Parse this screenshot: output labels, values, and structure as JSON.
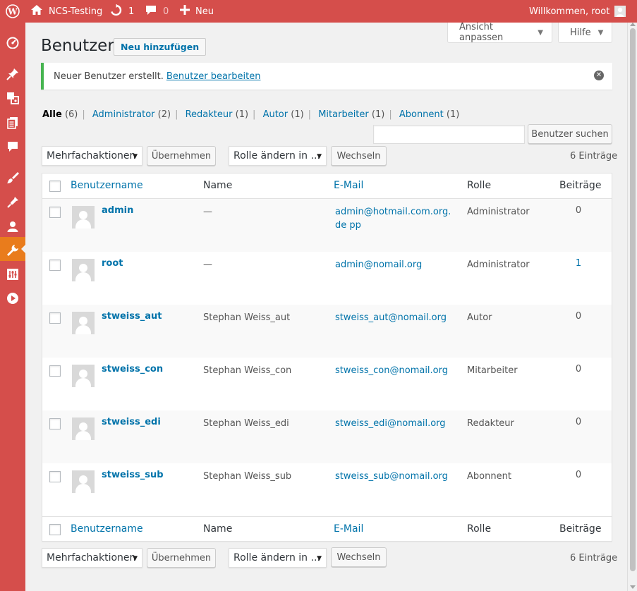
{
  "adminbar": {
    "site_name": "NCS-Testing",
    "updates_count": "1",
    "comments_count": "0",
    "new_label": "Neu",
    "greeting": "Willkommen, root"
  },
  "screen_meta": {
    "options_label": "Ansicht anpassen",
    "help_label": "Hilfe"
  },
  "page": {
    "title": "Benutzer",
    "add_new_label": "Neu hinzufügen"
  },
  "notice": {
    "message": "Neuer Benutzer erstellt.",
    "link": "Benutzer bearbeiten"
  },
  "filters": [
    {
      "label": "Alle",
      "count": "(6)"
    },
    {
      "label": "Administrator",
      "count": "(2)"
    },
    {
      "label": "Redakteur",
      "count": "(1)"
    },
    {
      "label": "Autor",
      "count": "(1)"
    },
    {
      "label": "Mitarbeiter",
      "count": "(1)"
    },
    {
      "label": "Abonnent",
      "count": "(1)"
    }
  ],
  "search": {
    "value": "",
    "button_label": "Benutzer suchen"
  },
  "tablenav": {
    "bulk_select": "Mehrfachaktionen",
    "apply_label": "Übernehmen",
    "role_select": "Rolle ändern in ...",
    "change_label": "Wechseln",
    "items_count": "6 Einträge"
  },
  "columns": {
    "username": "Benutzername",
    "name": "Name",
    "email": "E-Mail",
    "role": "Rolle",
    "posts": "Beiträge"
  },
  "users": [
    {
      "username": "admin",
      "name": "—",
      "email": "admin@hotmail.com.org.de pp",
      "role": "Administrator",
      "posts": "0"
    },
    {
      "username": "root",
      "name": "—",
      "email": "admin@nomail.org",
      "role": "Administrator",
      "posts": "1"
    },
    {
      "username": "stweiss_aut",
      "name": "Stephan Weiss_aut",
      "email": "stweiss_aut@nomail.org",
      "role": "Autor",
      "posts": "0"
    },
    {
      "username": "stweiss_con",
      "name": "Stephan Weiss_con",
      "email": "stweiss_con@nomail.org",
      "role": "Mitarbeiter",
      "posts": "0"
    },
    {
      "username": "stweiss_edi",
      "name": "Stephan Weiss_edi",
      "email": "stweiss_edi@nomail.org",
      "role": "Redakteur",
      "posts": "0"
    },
    {
      "username": "stweiss_sub",
      "name": "Stephan Weiss_sub",
      "email": "stweiss_sub@nomail.org",
      "role": "Abonnent",
      "posts": "0"
    }
  ],
  "colors": {
    "admin_bar": "#d54e4b",
    "current_menu": "#e97c1c",
    "link": "#0073aa",
    "notice_success": "#46b450"
  },
  "icons": [
    "wordpress-logo-icon",
    "home-icon",
    "updates-icon",
    "comments-icon",
    "plus-icon",
    "user-avatar-icon",
    "dashboard-icon",
    "posts-pin-icon",
    "media-icon",
    "pages-icon",
    "comments-menu-icon",
    "appearance-icon",
    "plugins-icon",
    "users-icon",
    "tools-icon",
    "settings-icon",
    "play-icon",
    "dismiss-icon"
  ]
}
